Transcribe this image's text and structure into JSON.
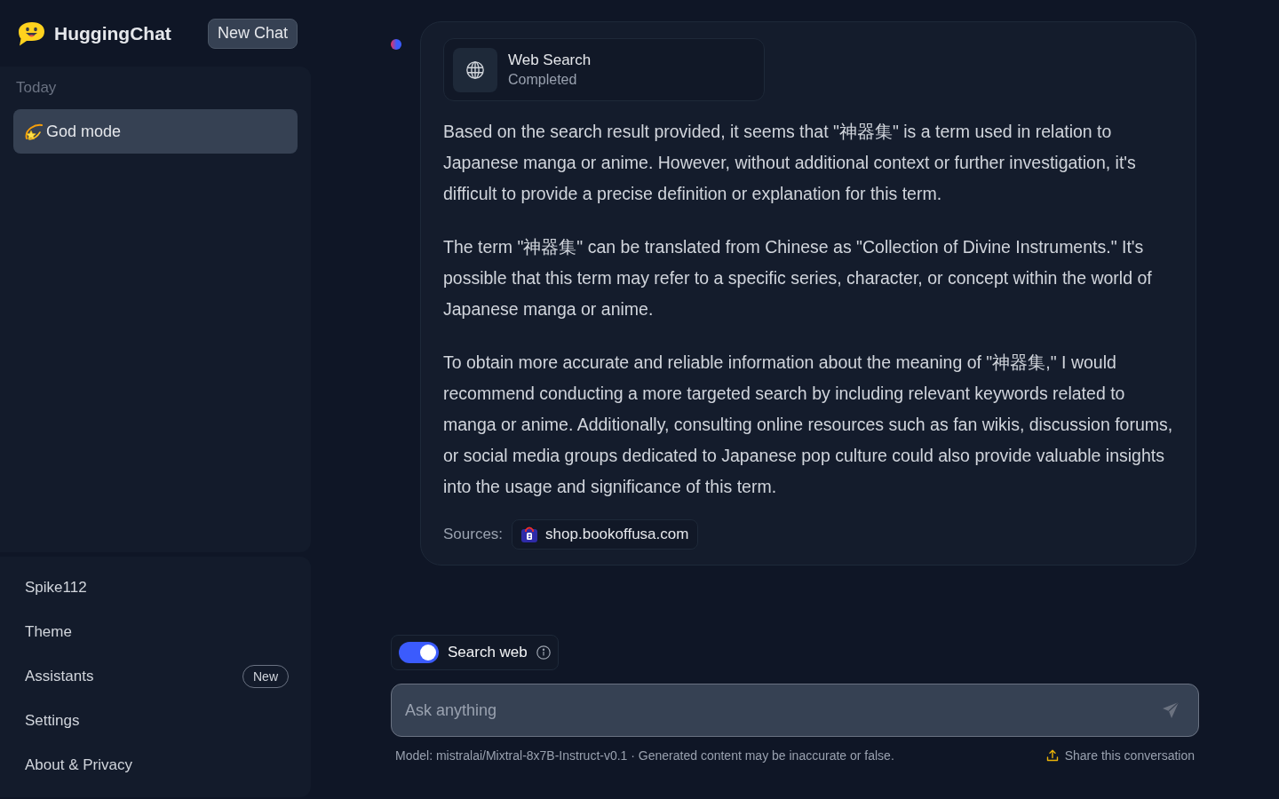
{
  "app": {
    "name": "HuggingChat",
    "new_chat_button": "New Chat"
  },
  "sidebar": {
    "groups": [
      {
        "label": "Today",
        "items": [
          {
            "title": "God mode",
            "selected": true
          }
        ]
      }
    ],
    "menu": [
      {
        "label": "Spike112"
      },
      {
        "label": "Theme"
      },
      {
        "label": "Assistants",
        "badge": "New"
      },
      {
        "label": "Settings"
      },
      {
        "label": "About & Privacy"
      }
    ]
  },
  "conversation": {
    "messages": [
      {
        "tool": {
          "title": "Web Search",
          "status": "Completed"
        },
        "paragraphs": [
          "Based on the search result provided, it seems that \"神器集\" is a term used in relation to Japanese manga or anime. However, without additional context or further investigation, it's difficult to provide a precise definition or explanation for this term.",
          "The term \"神器集\" can be translated from Chinese as \"Collection of Divine Instruments.\" It's possible that this term may refer to a specific series, character, or concept within the world of Japanese manga or anime.",
          "To obtain more accurate and reliable information about the meaning of \"神器集,\" I would recommend conducting a more targeted search by including relevant keywords related to manga or anime. Additionally, consulting online resources such as fan wikis, discussion forums, or social media groups dedicated to Japanese pop culture could also provide valuable insights into the usage and significance of this term."
        ],
        "sources_label": "Sources:",
        "sources": [
          {
            "domain": "shop.bookoffusa.com"
          }
        ]
      }
    ]
  },
  "composer": {
    "search_web": {
      "label": "Search web",
      "on": true
    },
    "input": {
      "placeholder": "Ask anything"
    },
    "footer": {
      "model_note": "Model: mistralai/Mixtral-8x7B-Instruct-v0.1 · Generated content may be inaccurate or false.",
      "share": "Share this conversation"
    }
  }
}
